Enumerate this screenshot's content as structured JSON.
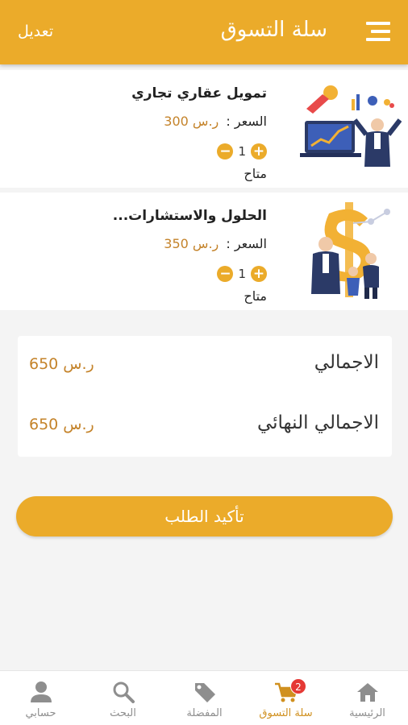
{
  "appbar": {
    "title": "سلة التسوق",
    "edit_label": "تعديل",
    "menu_icon": "menu-icon"
  },
  "items": [
    {
      "name": "تمويل عقاري تجاري",
      "price_label": "السعر :",
      "price_value": "ر.س 300",
      "quantity": "1",
      "availability": "متاح"
    },
    {
      "name": "الحلول والاستشارات...",
      "price_label": "السعر :",
      "price_value": "ر.س 350",
      "quantity": "1",
      "availability": "متاح"
    }
  ],
  "totals": {
    "total_label": "الاجمالي",
    "total_value": "ر.س 650",
    "grand_total_label": "الاجمالي النهائي",
    "grand_total_value": "ر.س 650"
  },
  "confirm_label": "تأكيد الطلب",
  "nav": {
    "home": "الرئيسية",
    "cart": "سلة التسوق",
    "cart_badge": "2",
    "favorites": "المفضلة",
    "search": "البحث",
    "account": "حسابي"
  },
  "colors": {
    "accent": "#ebab2a",
    "price": "#c4832a",
    "badge": "#e53935"
  }
}
